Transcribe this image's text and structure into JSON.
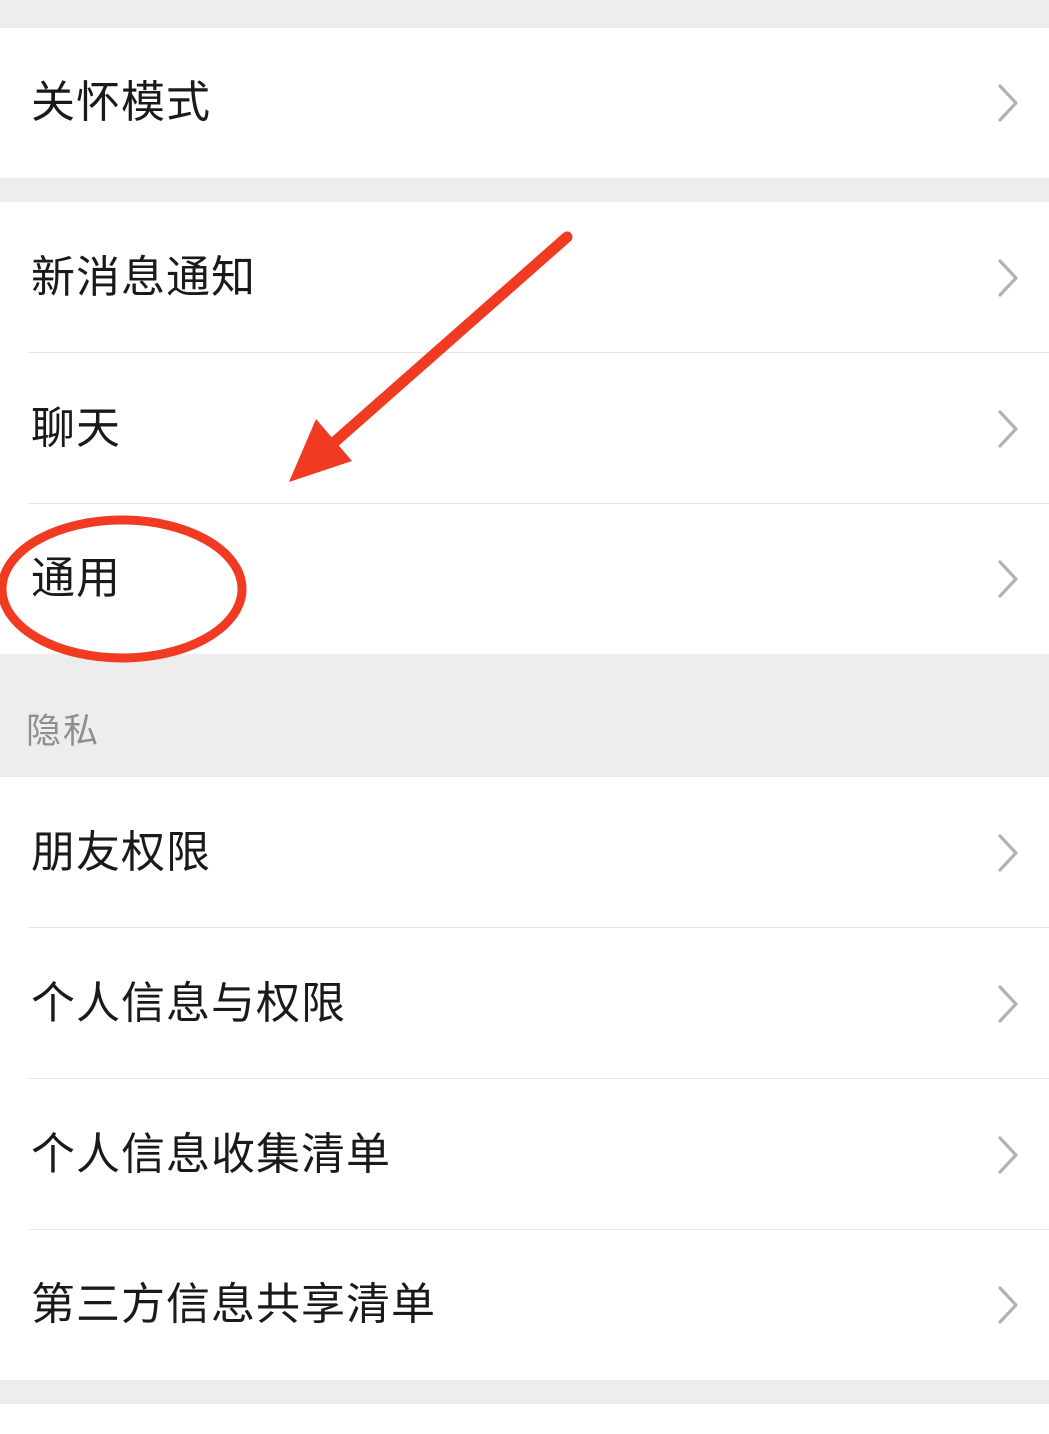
{
  "groups": [
    {
      "items": [
        {
          "label": "关怀模式"
        }
      ]
    },
    {
      "items": [
        {
          "label": "新消息通知"
        },
        {
          "label": "聊天"
        },
        {
          "label": "通用"
        }
      ]
    },
    {
      "header": "隐私",
      "items": [
        {
          "label": "朋友权限"
        },
        {
          "label": "个人信息与权限"
        },
        {
          "label": "个人信息收集清单"
        },
        {
          "label": "第三方信息共享清单"
        }
      ]
    }
  ],
  "colors": {
    "background": "#ededed",
    "cell": "#ffffff",
    "text": "#1a1a1a",
    "section_header_text": "#8f8f8f",
    "chevron": "#b2b2b2",
    "annotation": "#f13a22"
  },
  "icons": {
    "row_chevron": "chevron-right-icon",
    "annotation_arrow": "red-arrow-annotation",
    "annotation_circle": "red-circle-annotation"
  }
}
